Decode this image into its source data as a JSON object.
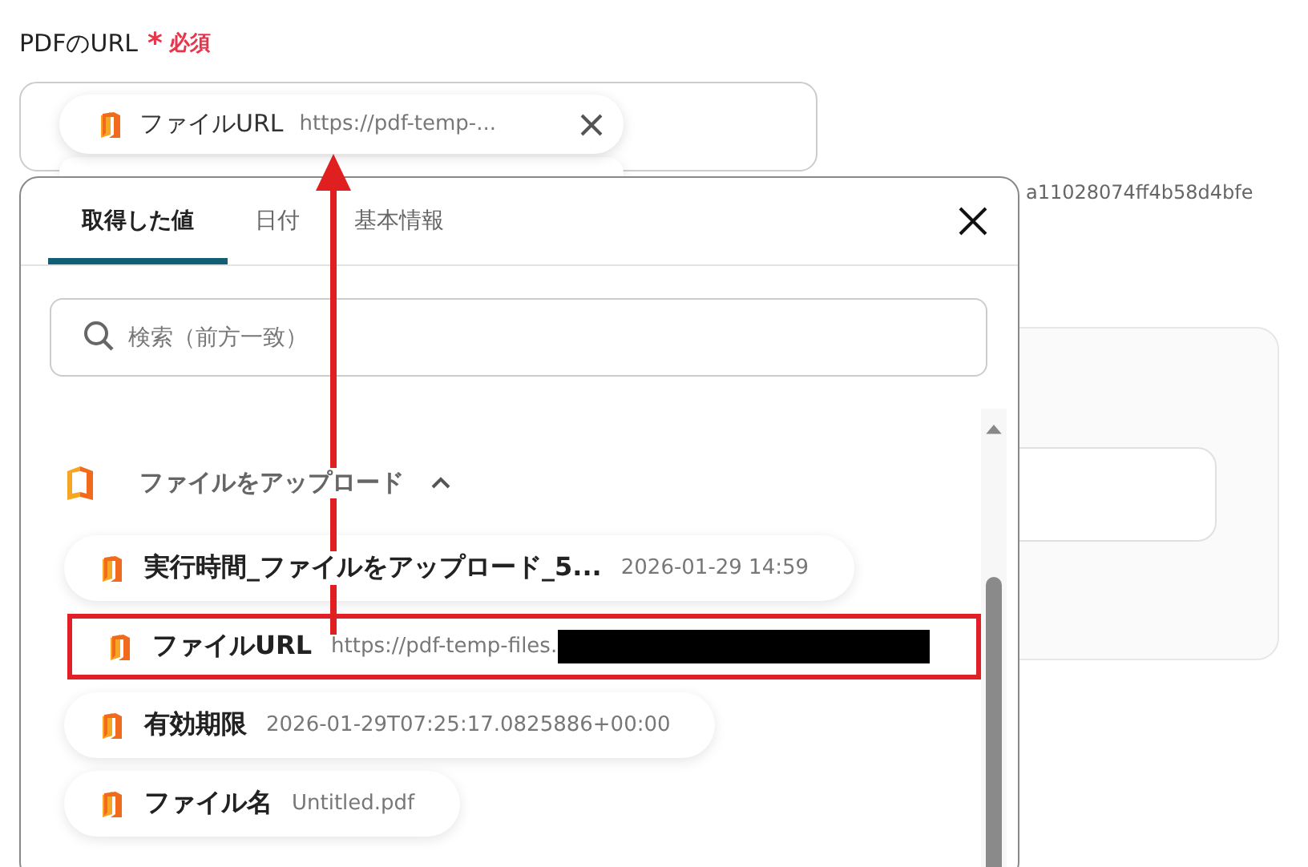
{
  "field": {
    "label": "PDFのURL",
    "required_mark": "*",
    "required_text": "必須",
    "chip": {
      "label": "ファイルURL",
      "value": "https://pdf-temp-..."
    }
  },
  "background": {
    "id_text": "a11028074ff4b58d4bfe"
  },
  "popover": {
    "tabs": [
      {
        "label": "取得した値",
        "selected": true
      },
      {
        "label": "日付",
        "selected": false
      },
      {
        "label": "基本情報",
        "selected": false
      }
    ],
    "search": {
      "placeholder": "検索（前方一致）"
    },
    "section": {
      "title": "ファイルをアップロード",
      "expanded": true
    },
    "items": [
      {
        "label": "実行時間_ファイルをアップロード_5...",
        "value": "2026-01-29 14:59",
        "highlighted": false,
        "redacted": false
      },
      {
        "label": "ファイルURL",
        "value": "https://pdf-temp-files.",
        "highlighted": true,
        "redacted": true
      },
      {
        "label": "有効期限",
        "value": "2026-01-29T07:25:17.0825886+00:00",
        "highlighted": false,
        "redacted": false
      },
      {
        "label": "ファイル名",
        "value": "Untitled.pdf",
        "highlighted": false,
        "redacted": false
      }
    ]
  }
}
